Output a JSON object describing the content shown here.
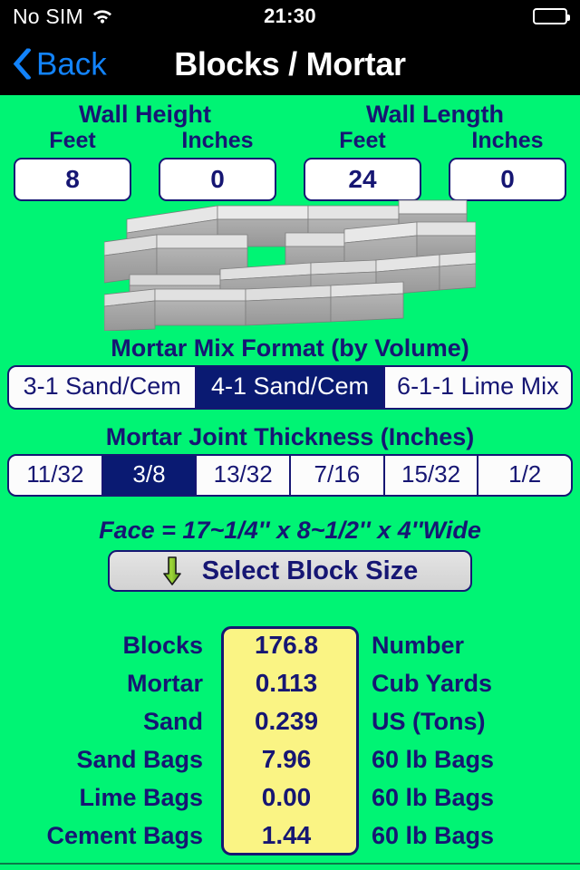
{
  "status_bar": {
    "carrier": "No SIM",
    "wifi_icon": "wifi-icon",
    "time": "21:30",
    "battery_icon": "battery-full-icon"
  },
  "nav_bar": {
    "back_label": "Back",
    "back_icon": "chevron-left-icon",
    "title": "Blocks / Mortar"
  },
  "dimensions": {
    "height_title": "Wall Height",
    "length_title": "Wall Length",
    "height_feet_label": "Feet",
    "height_inches_label": "Inches",
    "length_feet_label": "Feet",
    "length_inches_label": "Inches",
    "height_feet_value": "8",
    "height_inches_value": "0",
    "length_feet_value": "24",
    "length_inches_value": "0"
  },
  "wall_image": {
    "name": "concrete-block-wall-illustration"
  },
  "mortar_mix": {
    "heading": "Mortar Mix Format (by Volume)",
    "options": [
      {
        "label": "3-1 Sand/Cem",
        "selected": false
      },
      {
        "label": "4-1 Sand/Cem",
        "selected": true
      },
      {
        "label": "6-1-1 Lime Mix",
        "selected": false
      }
    ]
  },
  "joint_thickness": {
    "heading": "Mortar Joint Thickness (Inches)",
    "options": [
      {
        "label": "11/32",
        "selected": false
      },
      {
        "label": "3/8",
        "selected": true
      },
      {
        "label": "13/32",
        "selected": false
      },
      {
        "label": "7/16",
        "selected": false
      },
      {
        "label": "15/32",
        "selected": false
      },
      {
        "label": "1/2",
        "selected": false
      }
    ]
  },
  "block_size": {
    "face_text": "Face = 17~1/4'' x 8~1/2'' x 4''Wide",
    "button_label": "Select Block Size",
    "button_icon": "down-arrow-icon"
  },
  "results": {
    "rows": [
      {
        "label": "Blocks",
        "value": "176.8",
        "unit": "Number"
      },
      {
        "label": "Mortar",
        "value": "0.113",
        "unit": "Cub Yards"
      },
      {
        "label": "Sand",
        "value": "0.239",
        "unit": "US (Tons)"
      },
      {
        "label": "Sand Bags",
        "value": "7.96",
        "unit": "60 lb Bags"
      },
      {
        "label": "Lime Bags",
        "value": "0.00",
        "unit": "60 lb Bags"
      },
      {
        "label": "Cement Bags",
        "value": "1.44",
        "unit": "60 lb Bags"
      }
    ]
  },
  "colors": {
    "background_green": "#00F474",
    "ink_navy": "#161673",
    "selected_navy": "#0A1A72",
    "result_box_yellow": "#FAF484",
    "link_blue": "#1283FB"
  }
}
